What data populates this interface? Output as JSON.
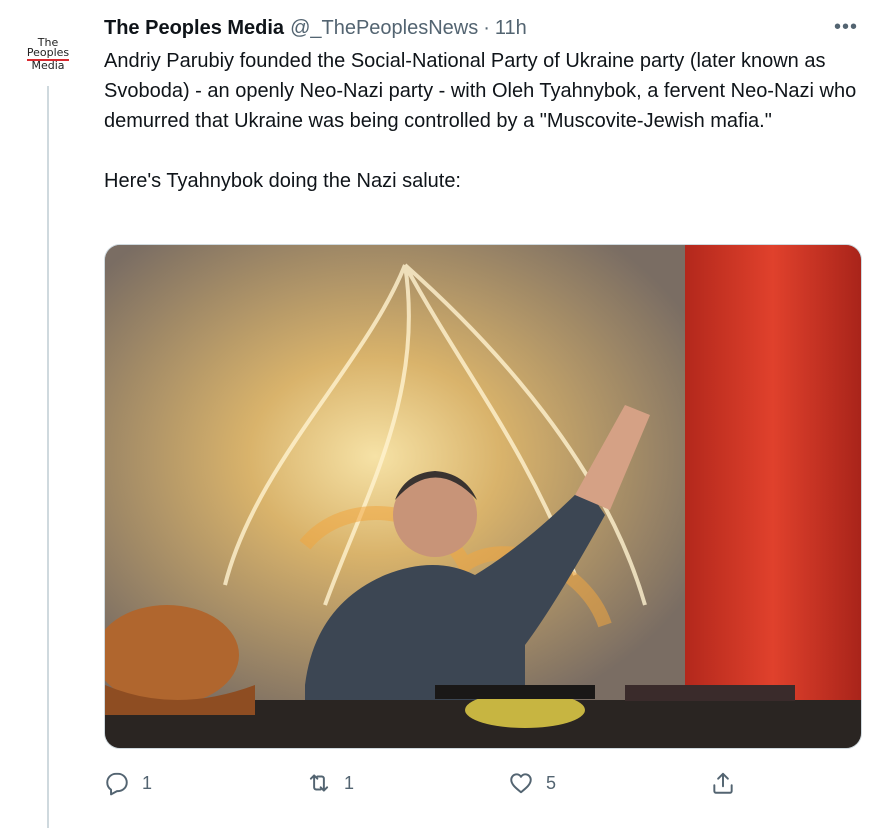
{
  "tweet": {
    "avatar": {
      "line1": "The",
      "line2": "Peoples",
      "line3": "Media"
    },
    "author_name": "The Peoples Media",
    "handle": "@_ThePeoplesNews",
    "separator": "·",
    "time": "11h",
    "more_icon": "•••",
    "text_paragraph_1": "Andriy Parubiy founded the Social-National Party of Ukraine party (later known as Svoboda) - an openly Neo-Nazi party - with Oleh Tyahnybok, a fervent Neo-Nazi who demurred that Ukraine was being controlled by a \"Muscovite-Jewish mafia.\"",
    "text_paragraph_2": "Here's Tyahnybok doing the Nazi salute:",
    "actions": {
      "reply_count": "1",
      "retweet_count": "1",
      "like_count": "5"
    }
  },
  "icons": [
    "reply-icon",
    "retweet-icon",
    "like-icon",
    "share-icon",
    "more-icon"
  ],
  "colors": {
    "secondary_text": "#536471",
    "border": "#cfd9de"
  }
}
